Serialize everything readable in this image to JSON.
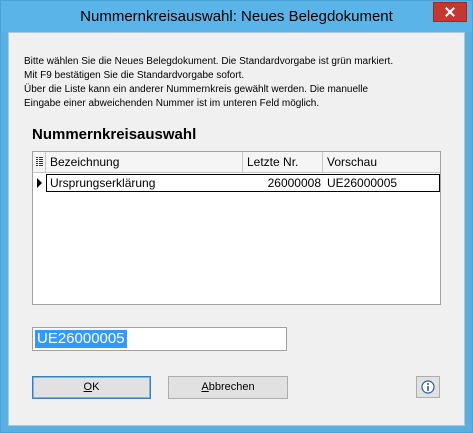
{
  "window": {
    "title": "Nummernkreisauswahl: Neues Belegdokument"
  },
  "intro": {
    "line1": "Bitte wählen Sie die Neues Belegdokument. Die Standardvorgabe ist grün markiert.",
    "line2": "Mit F9 bestätigen Sie die Standardvorgabe sofort.",
    "line3": "Über die Liste kann ein anderer Nummernkreis gewählt werden. Die manuelle",
    "line4": "Eingabe einer abweichenden Nummer ist im unteren Feld möglich."
  },
  "section": {
    "title": "Nummernkreisauswahl"
  },
  "grid": {
    "columns": [
      "Bezeichnung",
      "Letzte Nr.",
      "Vorschau"
    ],
    "rows": [
      {
        "bezeichnung": "Ursprungserklärung",
        "letzte_nr": "26000008",
        "vorschau": "UE26000005"
      }
    ]
  },
  "number_input": {
    "value": "UE26000005"
  },
  "buttons": {
    "ok": "OK",
    "ok_mnemonic": "O",
    "ok_rest": "K",
    "cancel_mnemonic": "A",
    "cancel_rest": "bbrechen",
    "cancel": "Abbrechen"
  },
  "icons": {
    "close": "close-icon",
    "column_chooser": "column-chooser-icon",
    "info": "info-icon"
  },
  "colors": {
    "titlebar": "#5ab4e8",
    "close": "#c7372f",
    "selection": "#3399ff"
  }
}
